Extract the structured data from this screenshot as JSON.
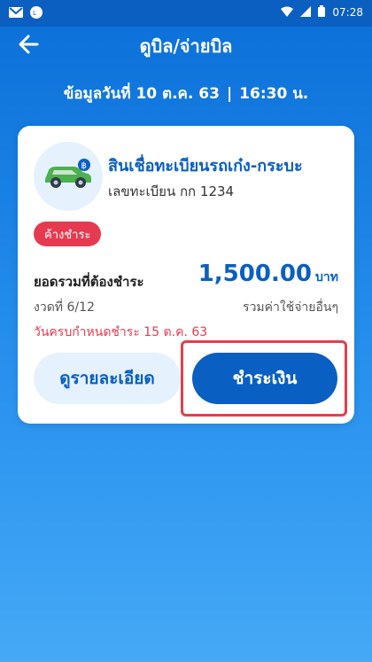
{
  "status_bar": {
    "time": "07:28",
    "icons": [
      "gmail-icon",
      "line-icon",
      "wifi-icon",
      "signal-4g-icon",
      "battery-icon"
    ]
  },
  "header": {
    "title": "ดูบิล/จ่ายบิล",
    "back_icon": "back-arrow-icon"
  },
  "info": {
    "date_text": "ข้อมูลวันที่ 10 ต.ค. 63",
    "separator": "|",
    "time_text": "16:30 น."
  },
  "bill": {
    "product_name": "สินเชื่อทะเบียนรถเก๋ง-กระบะ",
    "registration": "เลขทะเบียน กก 1234",
    "status_badge": "ค้างชำระ",
    "total_label": "ยอดรวมที่ต้องชำระ",
    "amount": "1,500.00",
    "currency": "บาท",
    "installment": "งวดที่ 6/12",
    "includes_fees": "รวมค่าใช้จ่ายอื่นๆ",
    "due_date": "วันครบกำหนดชำระ 15 ต.ค. 63",
    "detail_button": "ดูรายละเอียด",
    "pay_button": "ชำระเงิน"
  },
  "colors": {
    "primary": "#0a5fc2",
    "badge_red": "#e63a50",
    "highlight_border": "#e0404c",
    "light_blue": "#e5f1fd",
    "car_green": "#4caf50"
  }
}
